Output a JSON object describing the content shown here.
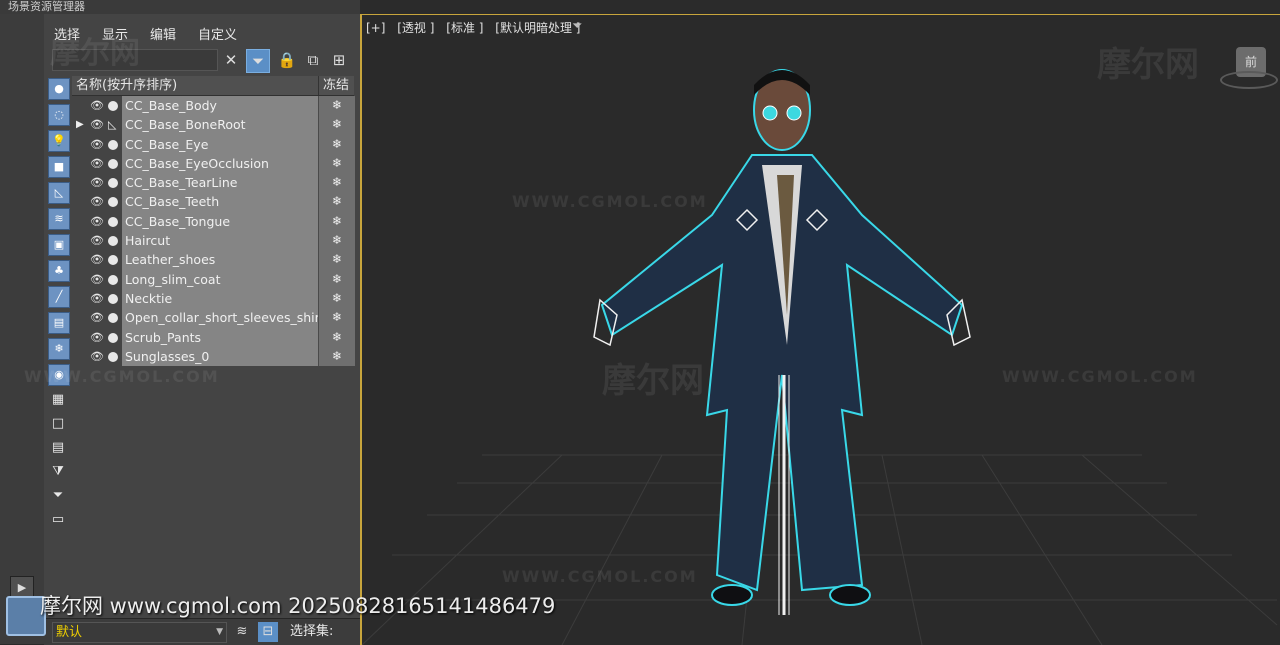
{
  "window": {
    "title_fragment": "场景资源管理器"
  },
  "menu": {
    "items": [
      "选择",
      "显示",
      "编辑",
      "自定义"
    ]
  },
  "list": {
    "header_name": "名称(按升序排序)",
    "header_freeze": "冻结",
    "rows": [
      {
        "name": "CC_Base_Body"
      },
      {
        "name": "CC_Base_BoneRoot"
      },
      {
        "name": "CC_Base_Eye"
      },
      {
        "name": "CC_Base_EyeOcclusion"
      },
      {
        "name": "CC_Base_TearLine"
      },
      {
        "name": "CC_Base_Teeth"
      },
      {
        "name": "CC_Base_Tongue"
      },
      {
        "name": "Haircut"
      },
      {
        "name": "Leather_shoes"
      },
      {
        "name": "Long_slim_coat"
      },
      {
        "name": "Necktie"
      },
      {
        "name": "Open_collar_short_sleeves_shirt"
      },
      {
        "name": "Scrub_Pants"
      },
      {
        "name": "Sunglasses_0"
      }
    ]
  },
  "bottom": {
    "layer_value": "默认",
    "selection_set_label": "选择集:"
  },
  "viewport": {
    "labels": [
      "[+]",
      "[透视 ]",
      "[标准 ]",
      "[默认明暗处理 ]"
    ],
    "viewcube_label": "前"
  },
  "watermarks": {
    "bottom_text": "摩尔网 www.cgmol.com 20250828165141486479",
    "cn": "摩尔网",
    "en": "WWW.CGMOL.COM"
  },
  "colors": {
    "accent": "#5b8fc6",
    "viewport_border": "#c8a53c",
    "selection_outline": "#39d8e8"
  }
}
